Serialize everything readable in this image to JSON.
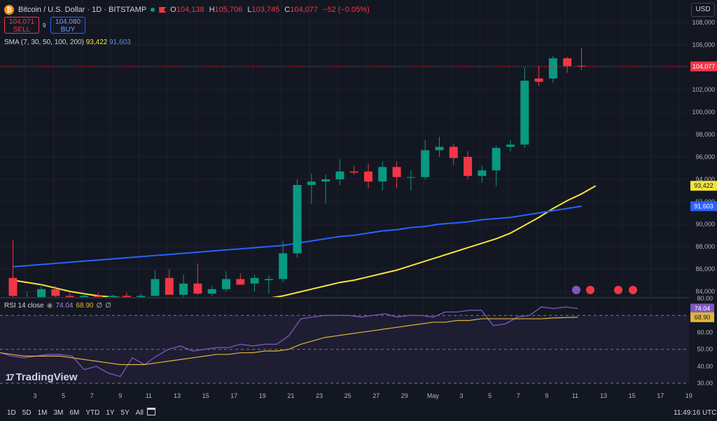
{
  "header": {
    "symbol": "Bitcoin / U.S. Dollar · 1D · BITSTAMP",
    "open_label": "O",
    "open": "104,138",
    "high_label": "H",
    "high": "105,706",
    "low_label": "L",
    "low": "103,745",
    "close_label": "C",
    "close": "104,077",
    "change": "−52 (−0.05%)",
    "sell_price": "104,071",
    "sell_label": "SELL",
    "spread": "9",
    "buy_price": "104,080",
    "buy_label": "BUY",
    "sma_label": "SMA (7, 30, 50, 100, 200)",
    "sma_value_1": "93,422",
    "sma_value_2": "91,603",
    "rsi_label": "RSI 14 close",
    "rsi_value_1": "74.04",
    "rsi_value_2": "68.90",
    "rsi_value_3": "∅",
    "rsi_value_4": "∅",
    "currency": "USD"
  },
  "footer": {
    "logo_text": "TradingView",
    "ranges": [
      "1D",
      "5D",
      "1M",
      "3M",
      "6M",
      "YTD",
      "1Y",
      "5Y",
      "All"
    ],
    "clock": "11:49:16 UTC"
  },
  "colors": {
    "background": "#131722",
    "up": "#089981",
    "down": "#f23645",
    "sma_fast": "#f5e33c",
    "sma_slow": "#2962ff",
    "rsi": "#7e57c2",
    "rsi_ma": "#e0b53a",
    "grid": "#1e222d"
  },
  "chart_data": [
    {
      "type": "candlestick",
      "ylim": [
        83500,
        110000
      ],
      "y_ticks": [
        84000,
        86000,
        88000,
        90000,
        92000,
        94000,
        96000,
        98000,
        100000,
        102000,
        104000,
        106000,
        108000
      ],
      "x_tick_labels": [
        "3",
        "5",
        "7",
        "9",
        "11",
        "13",
        "15",
        "17",
        "19",
        "21",
        "23",
        "25",
        "27",
        "29",
        "May",
        "3",
        "5",
        "7",
        "9",
        "11",
        "13",
        "15",
        "17",
        "19"
      ],
      "last_price": 104077,
      "last_price_label": "104,077",
      "candles": [
        {
          "o": 85200,
          "h": 88600,
          "l": 83500,
          "c": 83600
        },
        {
          "o": 83500,
          "h": 84000,
          "l": 83500,
          "c": 83500
        },
        {
          "o": 83500,
          "h": 84700,
          "l": 83500,
          "c": 84200
        },
        {
          "o": 84200,
          "h": 84500,
          "l": 83500,
          "c": 83600
        },
        {
          "o": 83600,
          "h": 83900,
          "l": 83500,
          "c": 83500
        },
        {
          "o": 83500,
          "h": 83800,
          "l": 83500,
          "c": 83600
        },
        {
          "o": 83600,
          "h": 83900,
          "l": 83500,
          "c": 83500
        },
        {
          "o": 83500,
          "h": 83700,
          "l": 83500,
          "c": 83600
        },
        {
          "o": 83600,
          "h": 83900,
          "l": 83500,
          "c": 83500
        },
        {
          "o": 83500,
          "h": 83800,
          "l": 83500,
          "c": 83600
        },
        {
          "o": 83600,
          "h": 85900,
          "l": 83600,
          "c": 85100
        },
        {
          "o": 85200,
          "h": 86000,
          "l": 83700,
          "c": 83700
        },
        {
          "o": 83700,
          "h": 85500,
          "l": 83500,
          "c": 84700
        },
        {
          "o": 84700,
          "h": 86500,
          "l": 83700,
          "c": 83800
        },
        {
          "o": 83800,
          "h": 84500,
          "l": 83600,
          "c": 84200
        },
        {
          "o": 84200,
          "h": 85800,
          "l": 84000,
          "c": 85100
        },
        {
          "o": 85100,
          "h": 85600,
          "l": 84600,
          "c": 84600
        },
        {
          "o": 84700,
          "h": 85500,
          "l": 84000,
          "c": 85200
        },
        {
          "o": 85000,
          "h": 85400,
          "l": 83800,
          "c": 85100
        },
        {
          "o": 85100,
          "h": 88500,
          "l": 84800,
          "c": 87400
        },
        {
          "o": 87400,
          "h": 94000,
          "l": 87000,
          "c": 93500
        },
        {
          "o": 93500,
          "h": 94500,
          "l": 91800,
          "c": 93800
        },
        {
          "o": 93800,
          "h": 94400,
          "l": 91800,
          "c": 94000
        },
        {
          "o": 94000,
          "h": 95800,
          "l": 93500,
          "c": 94700
        },
        {
          "o": 94700,
          "h": 95200,
          "l": 94400,
          "c": 94600
        },
        {
          "o": 94700,
          "h": 95400,
          "l": 93200,
          "c": 93800
        },
        {
          "o": 93800,
          "h": 95600,
          "l": 93000,
          "c": 95100
        },
        {
          "o": 95100,
          "h": 95600,
          "l": 93200,
          "c": 94200
        },
        {
          "o": 94200,
          "h": 94800,
          "l": 93000,
          "c": 94200
        },
        {
          "o": 94200,
          "h": 97500,
          "l": 94000,
          "c": 96600
        },
        {
          "o": 96600,
          "h": 97800,
          "l": 96000,
          "c": 96900
        },
        {
          "o": 96900,
          "h": 97200,
          "l": 95300,
          "c": 95900
        },
        {
          "o": 96000,
          "h": 96500,
          "l": 94000,
          "c": 94300
        },
        {
          "o": 94300,
          "h": 95200,
          "l": 93700,
          "c": 94800
        },
        {
          "o": 94800,
          "h": 97000,
          "l": 93400,
          "c": 96800
        },
        {
          "o": 96900,
          "h": 97500,
          "l": 96500,
          "c": 97100
        },
        {
          "o": 97100,
          "h": 104000,
          "l": 96800,
          "c": 102800
        },
        {
          "o": 103000,
          "h": 104100,
          "l": 102300,
          "c": 102700
        },
        {
          "o": 103000,
          "h": 105000,
          "l": 102600,
          "c": 104800
        },
        {
          "o": 104800,
          "h": 104900,
          "l": 103500,
          "c": 104100
        },
        {
          "o": 104138,
          "h": 105706,
          "l": 103745,
          "c": 104077
        }
      ],
      "sma_series": [
        {
          "name": "SMA 1",
          "value_label": "93,422",
          "values": [
            85000,
            84800,
            84600,
            84300,
            84000,
            83800,
            83600,
            83500,
            83400,
            83300,
            83300,
            83300,
            83300,
            83300,
            83300,
            83300,
            83300,
            83300,
            83400,
            83600,
            83900,
            84200,
            84500,
            84800,
            85000,
            85300,
            85600,
            85900,
            86300,
            86700,
            87100,
            87500,
            87900,
            88300,
            88700,
            89200,
            89900,
            90600,
            91400,
            92100,
            92700,
            93422
          ]
        },
        {
          "name": "SMA 2",
          "value_label": "91,603",
          "values": [
            86200,
            86300,
            86400,
            86500,
            86600,
            86700,
            86800,
            86900,
            87000,
            87100,
            87200,
            87300,
            87400,
            87500,
            87600,
            87700,
            87800,
            87900,
            88000,
            88100,
            88300,
            88500,
            88700,
            88900,
            89000,
            89200,
            89400,
            89500,
            89700,
            89800,
            90000,
            90100,
            90200,
            90400,
            90500,
            90600,
            90800,
            91000,
            91200,
            91400,
            91603
          ]
        }
      ]
    },
    {
      "type": "line",
      "title": "RSI 14 close",
      "ylim": [
        28,
        80
      ],
      "y_ticks": [
        30,
        40,
        50,
        60,
        70,
        80
      ],
      "y_tick_labels": [
        "30.00",
        "40.00",
        "50.00",
        "60.00",
        "70.00",
        "80.00"
      ],
      "bands": [
        30,
        50,
        70
      ],
      "series": [
        {
          "name": "RSI",
          "value_label": "74.04",
          "values": [
            48,
            46,
            45,
            46,
            47,
            47,
            46,
            38,
            40,
            36,
            34,
            45,
            41,
            46,
            50,
            52,
            49,
            50,
            51,
            51,
            53,
            52,
            53,
            53,
            58,
            68,
            69,
            70,
            70,
            70,
            69,
            70,
            71,
            69,
            70,
            70,
            69,
            72,
            72,
            73,
            73,
            64,
            65,
            69,
            70,
            75,
            74,
            75,
            74.04
          ]
        },
        {
          "name": "RSI MA",
          "value_label": "68.90",
          "values": [
            48,
            47,
            46,
            46,
            46,
            46,
            45,
            44,
            43,
            42,
            41,
            41,
            41,
            42,
            43,
            44,
            45,
            46,
            47,
            47,
            48,
            48,
            49,
            49,
            50,
            53,
            55,
            57,
            58,
            59,
            60,
            61,
            62,
            63,
            64,
            65,
            66,
            66,
            67,
            67,
            68,
            68,
            68,
            68,
            68,
            68,
            68.5,
            68.7,
            68.9
          ]
        }
      ]
    }
  ]
}
